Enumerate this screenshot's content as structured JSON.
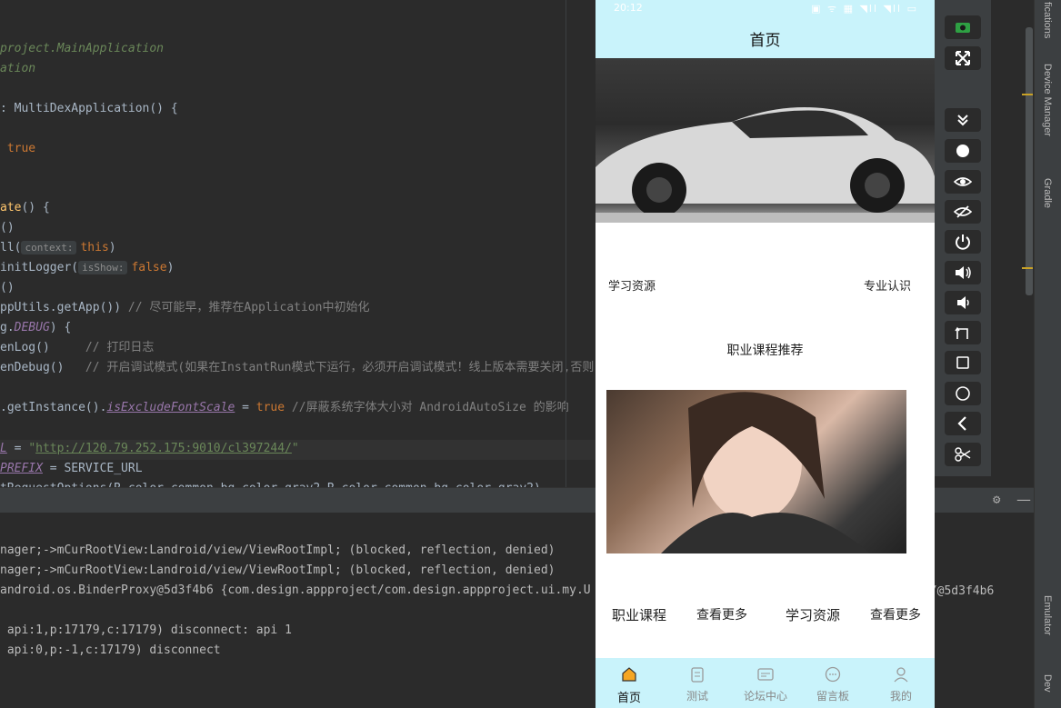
{
  "editor": {
    "lines": [
      {
        "segments": [
          {
            "t": "project.MainApplication",
            "c": "c-italic-green"
          }
        ]
      },
      {
        "segments": [
          {
            "t": "ation",
            "c": "c-italic-green"
          }
        ]
      },
      {
        "segments": [
          {
            "t": ": MultiDexApplication() {",
            "c": ""
          }
        ]
      },
      {
        "segments": [
          {
            "t": " true",
            "c": "c-orange"
          }
        ]
      },
      {
        "segments": [
          {
            "t": "ate",
            "c": "c-yellow"
          },
          {
            "t": "() {",
            "c": ""
          }
        ]
      },
      {
        "segments": [
          {
            "t": "()",
            "c": ""
          }
        ]
      },
      {
        "segments": [
          {
            "t": "ll(",
            "c": ""
          },
          {
            "t": "context:",
            "c": "hint"
          },
          {
            "t": "this",
            "c": "c-orange"
          },
          {
            "t": ")",
            "c": ""
          }
        ]
      },
      {
        "segments": [
          {
            "t": "initLogger(",
            "c": ""
          },
          {
            "t": "isShow:",
            "c": "hint"
          },
          {
            "t": "false",
            "c": "c-orange"
          },
          {
            "t": ")",
            "c": ""
          }
        ]
      },
      {
        "segments": [
          {
            "t": "()",
            "c": ""
          }
        ]
      },
      {
        "segments": [
          {
            "t": "ppUtils.getApp()) ",
            "c": ""
          },
          {
            "t": "// 尽可能早，推荐在Application中初始化",
            "c": "c-gray"
          }
        ]
      },
      {
        "segments": [
          {
            "t": "g.",
            "c": ""
          },
          {
            "t": "DEBUG",
            "c": "c-purple"
          },
          {
            "t": ") {",
            "c": ""
          }
        ]
      },
      {
        "segments": [
          {
            "t": "enLog()     ",
            "c": ""
          },
          {
            "t": "// 打印日志",
            "c": "c-gray"
          }
        ]
      },
      {
        "segments": [
          {
            "t": "enDebug()   ",
            "c": ""
          },
          {
            "t": "// 开启调试模式(如果在InstantRun模式下运行，必须开启调试模式！线上版本需要关闭,否则",
            "c": "c-gray"
          }
        ]
      },
      {
        "segments": [
          {
            "t": ".getInstance().",
            "c": ""
          },
          {
            "t": "isExcludeFontScale",
            "c": "c-underline"
          },
          {
            "t": " = ",
            "c": ""
          },
          {
            "t": "true",
            "c": "c-orange"
          },
          {
            "t": " //屏蔽系统字体大小对 AndroidAutoSize 的影响",
            "c": "c-gray"
          }
        ]
      },
      {
        "segments": [
          {
            "t": "L",
            "c": "c-underline"
          },
          {
            "t": " = ",
            "c": ""
          },
          {
            "t": "\"",
            "c": "c-green"
          },
          {
            "t": "http://120.79.252.175:9010/cl397244/",
            "c": "c-link"
          },
          {
            "t": "\"",
            "c": "c-green"
          }
        ]
      },
      {
        "segments": [
          {
            "t": "PREFIX",
            "c": "c-underline"
          },
          {
            "t": " = SERVICE_URL",
            "c": ""
          }
        ]
      },
      {
        "segments": [
          {
            "t": "tRequestOptions(R.color.common_bg_color_gray2,R.color.common_bg_color_gray2)",
            "c": ""
          }
        ]
      }
    ]
  },
  "log": {
    "lines": [
      "nager;->mCurRootView:Landroid/view/ViewRootImpl; (blocked, reflection, denied)",
      "nager;->mCurRootView:Landroid/view/ViewRootImpl; (blocked, reflection, denied)",
      "android.os.BinderProxy@5d3f4b6 {com.design.appproject/com.design.appproject.ui.my.U",
      "",
      " api:1,p:17179,c:17179) disconnect: api 1",
      " api:0,p:-1,c:17179) disconnect"
    ],
    "trailing": "y/@5d3f4b6"
  },
  "side_tools": [
    "fications",
    "Device Manager",
    "Gradle",
    "Emulator",
    "Dev"
  ],
  "phone": {
    "status_time": "20:12",
    "status_icons": "▣ ᯤ ▦ ◥ll ◥ll ▭",
    "title": "首页",
    "left_link": "学习资源",
    "right_link": "专业认识",
    "section_title": "职业课程推荐",
    "bottom_row": [
      "职业课程",
      "查看更多",
      "学习资源",
      "查看更多"
    ],
    "tabs": [
      {
        "label": "首页",
        "icon": "home-icon",
        "active": true
      },
      {
        "label": "测试",
        "icon": "document-icon",
        "active": false
      },
      {
        "label": "论坛中心",
        "icon": "forum-icon",
        "active": false
      },
      {
        "label": "留言板",
        "icon": "chat-icon",
        "active": false
      },
      {
        "label": "我的",
        "icon": "user-icon",
        "active": false
      }
    ]
  },
  "colors": {
    "appbar": "#c9f3fb",
    "ide_bg": "#2b2b2b",
    "active_tab_icon": "#f5a623"
  }
}
